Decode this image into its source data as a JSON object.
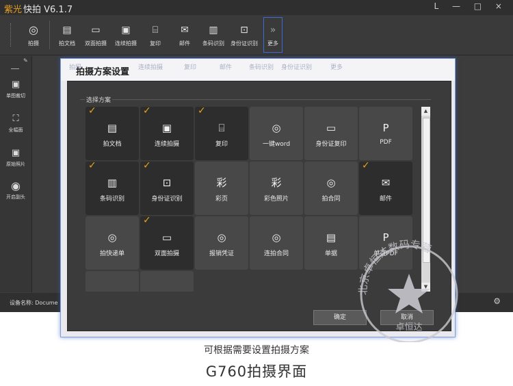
{
  "app": {
    "title_brand": "紫光",
    "title": "快拍 V6.1.7",
    "window_controls": "L — □ ×"
  },
  "toolbar": {
    "items": [
      {
        "label": "拍摄",
        "icon": "camera-icon"
      },
      {
        "label": "拍文档",
        "icon": "document-icon"
      },
      {
        "label": "双面拍摄",
        "icon": "id-card-icon"
      },
      {
        "label": "连续拍摄",
        "icon": "burst-camera-icon"
      },
      {
        "label": "复印",
        "icon": "copy-icon"
      },
      {
        "label": "邮件",
        "icon": "mail-icon"
      },
      {
        "label": "条码识别",
        "icon": "barcode-icon"
      },
      {
        "label": "身份证识别",
        "icon": "id-scan-icon"
      },
      {
        "label": "更多",
        "icon": "chevron-double-right-icon"
      }
    ]
  },
  "sidebar": {
    "items": [
      {
        "label": "单图裁切",
        "icon": "image-crop-icon"
      },
      {
        "label": "全幅面",
        "icon": "full-frame-icon"
      },
      {
        "label": "原始照片",
        "icon": "image-icon"
      },
      {
        "label": "开启副头",
        "icon": "secondary-camera-icon"
      }
    ]
  },
  "status": {
    "device_label": "设备名称:",
    "device_value": "Docume"
  },
  "dialog": {
    "title": "拍摄方案设置",
    "ghost_labels": [
      "拍摄",
      "连续拍摄",
      "复印",
      "邮件",
      "条码识别",
      "身份证识别",
      "更多"
    ],
    "group_label": "选择方案",
    "tiles": [
      {
        "label": "拍文档",
        "icon": "document-icon",
        "checked": true
      },
      {
        "label": "连续拍摄",
        "icon": "burst-camera-icon",
        "checked": true
      },
      {
        "label": "复印",
        "icon": "copy-icon",
        "checked": true
      },
      {
        "label": "一键word",
        "icon": "camera-icon",
        "checked": false
      },
      {
        "label": "身份证复印",
        "icon": "id-card-icon",
        "checked": false
      },
      {
        "label": "PDF",
        "icon": "pdf-icon",
        "checked": false
      },
      {
        "label": "条码识别",
        "icon": "barcode-icon",
        "checked": true
      },
      {
        "label": "身份证识别",
        "icon": "id-scan-icon",
        "checked": true
      },
      {
        "label": "彩页",
        "icon": "color-page-icon",
        "checked": false
      },
      {
        "label": "彩色照片",
        "icon": "color-photo-icon",
        "checked": false
      },
      {
        "label": "拍合同",
        "icon": "camera-icon",
        "checked": false
      },
      {
        "label": "邮件",
        "icon": "mail-icon",
        "checked": true
      },
      {
        "label": "拍快递单",
        "icon": "camera-icon",
        "checked": false
      },
      {
        "label": "双面拍摄",
        "icon": "id-card-icon",
        "checked": true
      },
      {
        "label": "报销凭证",
        "icon": "camera-icon",
        "checked": false
      },
      {
        "label": "连拍合同",
        "icon": "camera-icon",
        "checked": false
      },
      {
        "label": "单据",
        "icon": "document-icon",
        "checked": false
      },
      {
        "label": "单页PDF",
        "icon": "pdf-icon",
        "checked": false
      }
    ],
    "ok_label": "确定",
    "cancel_label": "取消"
  },
  "stamp": {
    "text": "北京卓恒达数码专营",
    "bottom": "卓恒达"
  },
  "captions": {
    "line1": "可根据需要设置拍摄方案",
    "line2": "G760拍摄界面"
  },
  "colors": {
    "check": "#e8a020",
    "dialog_border": "#7f9fdc",
    "panel_bg": "#3b3b3b"
  }
}
